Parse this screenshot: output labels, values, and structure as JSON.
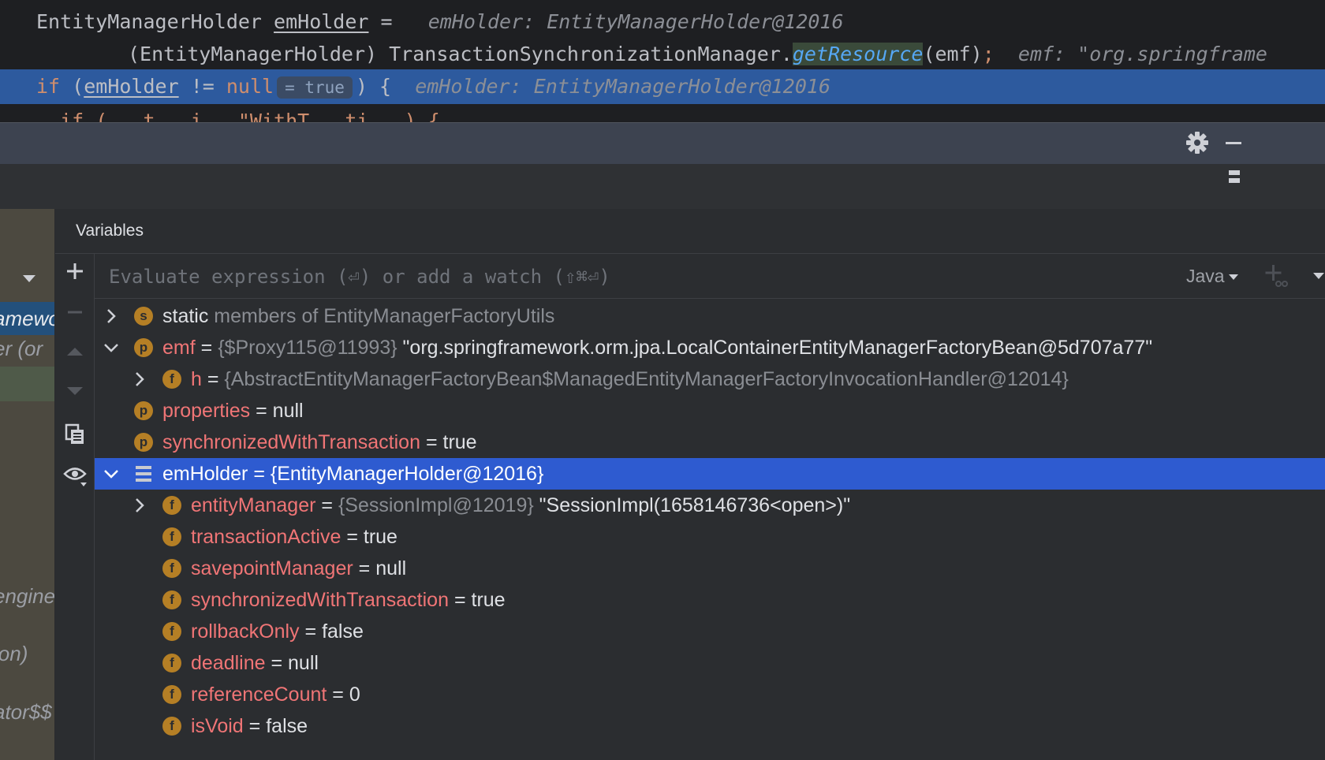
{
  "editor": {
    "line1": {
      "type": "EntityManagerHolder",
      "var": "emHolder",
      "op": " =",
      "hint": "emHolder: EntityManagerHolder@12016"
    },
    "line2": {
      "cast": "(EntityManagerHolder) TransactionSynchronizationManager.",
      "method": "getResource",
      "args": "(emf)",
      "semi": ";",
      "hint": "emf: \"org.springframe"
    },
    "line3": {
      "kw_if": "if",
      "paren_open": " (",
      "var": "emHolder",
      "op": " != ",
      "kw_null": "null",
      "inlay": "= true",
      "rest": ") {",
      "hint": "emHolder: EntityManagerHolder@12016"
    },
    "line4_partial": "  if (   t   i   \"WithT   ti   ) {"
  },
  "panel": {
    "variables_title": "Variables",
    "watch_placeholder": "Evaluate expression (⏎) or add a watch (⇧⌘⏎)",
    "language": "Java",
    "frames_partial": [
      "amewo",
      "er (or",
      "engine",
      "ion)",
      "ator$$"
    ]
  },
  "tree": [
    {
      "expanded": false,
      "badge": "s",
      "kind": "static",
      "name": "static",
      "rest": " members of EntityManagerFactoryUtils"
    },
    {
      "expanded": true,
      "badge": "p",
      "name": "emf",
      "eq": " = ",
      "type": "{$Proxy115@11993}",
      "value": " \"org.springframework.orm.jpa.LocalContainerEntityManagerFactoryBean@5d707a77\""
    },
    {
      "expanded": false,
      "badge": "f",
      "name": "h",
      "eq": " = ",
      "type": "{AbstractEntityManagerFactoryBean$ManagedEntityManagerFactoryInvocationHandler@12014}",
      "value": ""
    },
    {
      "badge": "p",
      "name": "properties",
      "eq": " = ",
      "value": "null"
    },
    {
      "badge": "p",
      "name": "synchronizedWithTransaction",
      "eq": " = ",
      "value": "true"
    },
    {
      "expanded": true,
      "selected": true,
      "badge": "list",
      "name": "emHolder",
      "eq": " = ",
      "value": "{EntityManagerHolder@12016}"
    },
    {
      "expanded": false,
      "badge": "f",
      "name": "entityManager",
      "eq": " = ",
      "type": "{SessionImpl@12019}",
      "value": " \"SessionImpl(1658146736<open>)\""
    },
    {
      "badge": "f",
      "name": "transactionActive",
      "eq": " = ",
      "value": "true"
    },
    {
      "badge": "f",
      "name": "savepointManager",
      "eq": " = ",
      "value": "null"
    },
    {
      "badge": "f",
      "name": "synchronizedWithTransaction",
      "eq": " = ",
      "value": "true"
    },
    {
      "badge": "f",
      "name": "rollbackOnly",
      "eq": " = ",
      "value": "false"
    },
    {
      "badge": "f",
      "name": "deadline",
      "eq": " = ",
      "value": "null"
    },
    {
      "badge": "f",
      "name": "referenceCount",
      "eq": " = ",
      "value": "0"
    },
    {
      "badge": "f",
      "name": "isVoid",
      "eq": " = ",
      "value": "false"
    }
  ],
  "icons": {
    "settings": "gear-icon",
    "minimize": "minimize-icon",
    "layout": "layout-icon",
    "add_watch": "plus-icon",
    "remove_watch": "minus-icon",
    "move_up": "arrow-up-icon",
    "move_down": "arrow-down-icon",
    "duplicate": "copy-icon",
    "show_watches": "eye-icon"
  },
  "colors": {
    "selection": "#2e5bd0",
    "editor_highlight": "#2d5a9e",
    "var_name": "#f07576",
    "badge": "#b57f25",
    "keyword": "#cf8e6d"
  }
}
